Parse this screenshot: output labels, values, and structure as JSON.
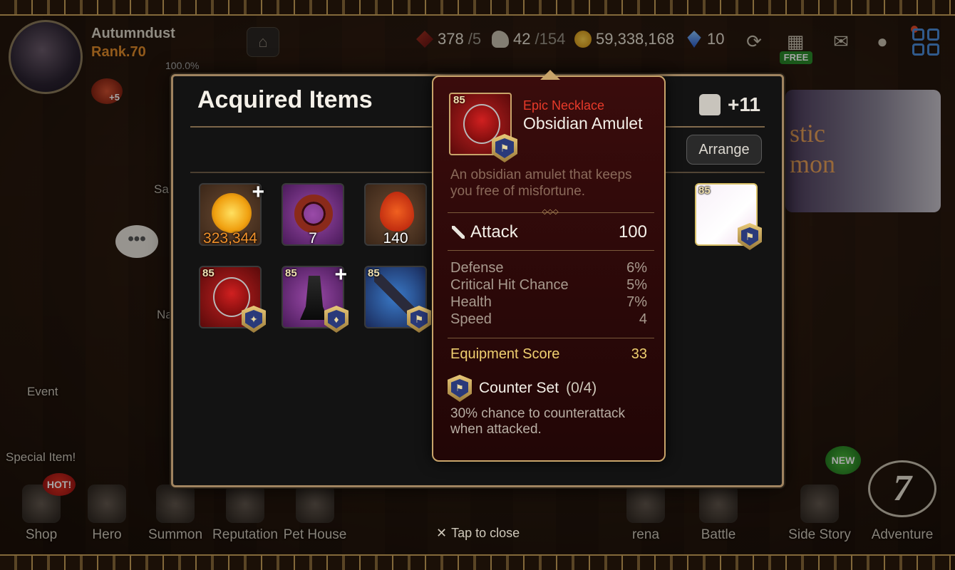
{
  "player": {
    "name": "Autumndust",
    "rank": "Rank.70",
    "progress": "100.0%",
    "badge_count": "+5"
  },
  "resources": {
    "energy": {
      "value": "378",
      "max": "/5"
    },
    "stamina": {
      "value": "42",
      "max": "/154"
    },
    "gold": "59,338,168",
    "gems": "10"
  },
  "hud": {
    "free_label": "FREE"
  },
  "side": {
    "chat": "•••",
    "event": "Event",
    "special": "Special Item!",
    "left_clipped_1": "Sa",
    "left_clipped_2": "Na"
  },
  "banner": {
    "text": "stic\nmon"
  },
  "nav": {
    "items": [
      {
        "label": "Shop"
      },
      {
        "label": "Hero"
      },
      {
        "label": "Summon"
      },
      {
        "label": "Reputation"
      },
      {
        "label": "Pet House"
      },
      {
        "label": "rena"
      },
      {
        "label": "Battle"
      },
      {
        "label": "Side Story"
      },
      {
        "label": "Adventure"
      }
    ],
    "hot": "HOT!",
    "new": "NEW",
    "adventure_num": "7",
    "tap_close": "Tap to close",
    "close_glyph": "✕"
  },
  "panel": {
    "title": "Acquired Items",
    "bag_count": "+11",
    "arrange": "Arrange",
    "items": [
      {
        "qty": "323,344"
      },
      {
        "qty": "7"
      },
      {
        "qty": "140"
      },
      {
        "level": "85"
      },
      {
        "level": "85"
      },
      {
        "level": "85"
      },
      {
        "level": "85"
      }
    ]
  },
  "tooltip": {
    "level": "85",
    "rarity": "Epic Necklace",
    "name": "Obsidian Amulet",
    "description": "An obsidian amulet that keeps you free of misfortune.",
    "ornament": "◇◇◇",
    "main_stat": {
      "label": "Attack",
      "value": "100"
    },
    "substats": [
      {
        "label": "Defense",
        "value": "6%"
      },
      {
        "label": "Critical Hit Chance",
        "value": "5%"
      },
      {
        "label": "Health",
        "value": "7%"
      },
      {
        "label": "Speed",
        "value": "4"
      }
    ],
    "score": {
      "label": "Equipment Score",
      "value": "33"
    },
    "set": {
      "name": "Counter Set",
      "progress": "(0/4)",
      "description": "30% chance to counterattack when attacked."
    }
  }
}
